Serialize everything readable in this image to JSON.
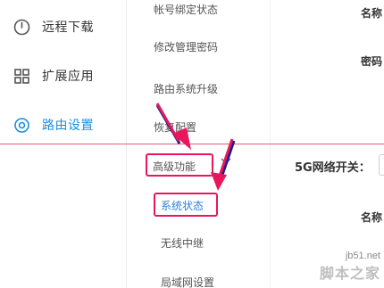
{
  "nav": {
    "items": [
      {
        "label": "远程下载",
        "icon": "power-icon"
      },
      {
        "label": "扩展应用",
        "icon": "apps-grid-icon"
      },
      {
        "label": "路由设置",
        "icon": "gear-icon",
        "active": true
      }
    ]
  },
  "submenu": {
    "items": [
      "帐号绑定状态",
      "修改管理密码",
      "路由系统升级",
      "恢复配置",
      "高级功能",
      "系统状态",
      "无线中继",
      "局域网设置"
    ]
  },
  "content": {
    "name_label_1": "名称",
    "password_label": "密码",
    "switch_5g_label": "5G网络开关：",
    "name_label_2": "名称"
  },
  "watermark": {
    "site": "jb51.net",
    "text": "脚本之家"
  },
  "colors": {
    "accent": "#1c8de0",
    "highlight_box": "#e8175d",
    "divider_line": "#e85c7a"
  }
}
